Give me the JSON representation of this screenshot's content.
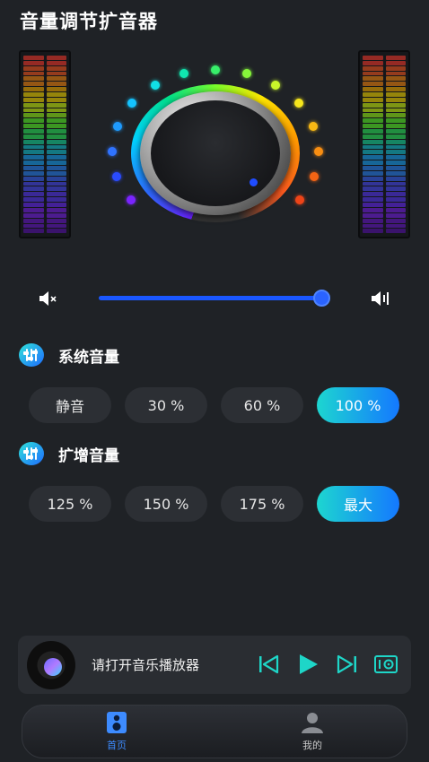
{
  "header": {
    "title": "音量调节扩音器"
  },
  "volume": {
    "level_percent": 100,
    "knob_level_percent": 100
  },
  "sections": [
    {
      "title": "系统音量",
      "buttons": [
        "静音",
        "30 %",
        "60 %",
        "100 %"
      ],
      "active_index": 3
    },
    {
      "title": "扩增音量",
      "buttons": [
        "125 %",
        "150 %",
        "175 %",
        "最大"
      ],
      "active_index": 3
    }
  ],
  "player": {
    "prompt": "请打开音乐播放器"
  },
  "tabs": [
    {
      "label": "首页",
      "active": true
    },
    {
      "label": "我的",
      "active": false
    }
  ],
  "colors": {
    "accent": "#1a57ff",
    "active_start": "#1dd6d0",
    "active_end": "#1478ff",
    "tab_active": "#3d8bff"
  },
  "icons": [
    "speaker-mute-icon",
    "speaker-loud-icon",
    "equalizer-icon",
    "previous-icon",
    "play-icon",
    "next-icon",
    "speaker-box-icon",
    "home-icon",
    "user-icon"
  ]
}
